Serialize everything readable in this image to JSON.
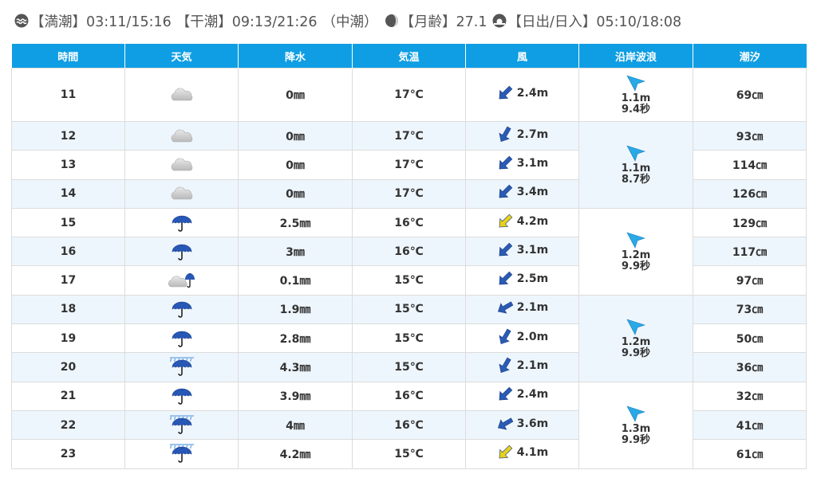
{
  "summary": {
    "tide_high": "【満潮】03:11/15:16",
    "tide_low": "【干潮】09:13/21:26",
    "tide_type": "（中潮）",
    "moon_age": "【月齢】27.1",
    "sun": "【日出/日入】05:10/18:08"
  },
  "headers": [
    "時間",
    "天気",
    "降水",
    "気温",
    "風",
    "沿岸波浪",
    "潮汐"
  ],
  "rows": [
    {
      "hour": "11",
      "weather": "cloudy-icon",
      "rain": "0㎜",
      "temp": "17℃",
      "wind_dir": 225,
      "wind_color": "#2a5bb5",
      "wind": "2.4m",
      "tide": "69㎝"
    },
    {
      "hour": "12",
      "weather": "cloudy-icon",
      "rain": "0㎜",
      "temp": "17℃",
      "wind_dir": 210,
      "wind_color": "#2a5bb5",
      "wind": "2.7m",
      "tide": "93㎝"
    },
    {
      "hour": "13",
      "weather": "cloudy-icon",
      "rain": "0㎜",
      "temp": "17℃",
      "wind_dir": 225,
      "wind_color": "#2a5bb5",
      "wind": "3.1m",
      "tide": "114㎝"
    },
    {
      "hour": "14",
      "weather": "cloudy-icon",
      "rain": "0㎜",
      "temp": "17℃",
      "wind_dir": 225,
      "wind_color": "#2a5bb5",
      "wind": "3.4m",
      "tide": "126㎝"
    },
    {
      "hour": "15",
      "weather": "rain-umbrella-icon",
      "rain": "2.5㎜",
      "temp": "16℃",
      "wind_dir": 225,
      "wind_color": "#e8d21a",
      "wind": "4.2m",
      "tide": "129㎝"
    },
    {
      "hour": "16",
      "weather": "rain-umbrella-icon",
      "rain": "3㎜",
      "temp": "16℃",
      "wind_dir": 225,
      "wind_color": "#2a5bb5",
      "wind": "3.1m",
      "tide": "117㎝"
    },
    {
      "hour": "17",
      "weather": "cloud-umbrella-icon",
      "rain": "0.1㎜",
      "temp": "15℃",
      "wind_dir": 225,
      "wind_color": "#2a5bb5",
      "wind": "2.5m",
      "tide": "97㎝"
    },
    {
      "hour": "18",
      "weather": "rain-umbrella-icon",
      "rain": "1.9㎜",
      "temp": "15℃",
      "wind_dir": 240,
      "wind_color": "#2a5bb5",
      "wind": "2.1m",
      "tide": "73㎝"
    },
    {
      "hour": "19",
      "weather": "rain-umbrella-icon",
      "rain": "2.8㎜",
      "temp": "15℃",
      "wind_dir": 210,
      "wind_color": "#2a5bb5",
      "wind": "2.0m",
      "tide": "50㎝"
    },
    {
      "hour": "20",
      "weather": "heavy-rain-umbrella-icon",
      "rain": "4.3㎜",
      "temp": "15℃",
      "wind_dir": 210,
      "wind_color": "#2a5bb5",
      "wind": "2.1m",
      "tide": "36㎝"
    },
    {
      "hour": "21",
      "weather": "rain-umbrella-icon",
      "rain": "3.9㎜",
      "temp": "16℃",
      "wind_dir": 225,
      "wind_color": "#2a5bb5",
      "wind": "2.4m",
      "tide": "32㎝"
    },
    {
      "hour": "22",
      "weather": "heavy-rain-umbrella-icon",
      "rain": "4㎜",
      "temp": "16℃",
      "wind_dir": 240,
      "wind_color": "#2a5bb5",
      "wind": "3.6m",
      "tide": "41㎝"
    },
    {
      "hour": "23",
      "weather": "heavy-rain-umbrella-icon",
      "rain": "4.2㎜",
      "temp": "15℃",
      "wind_dir": 225,
      "wind_color": "#e8d21a",
      "wind": "4.1m",
      "tide": "61㎝"
    }
  ],
  "waves": [
    {
      "height": "1.1m",
      "period": "9.4秒",
      "span": 1
    },
    {
      "height": "1.1m",
      "period": "8.7秒",
      "span": 3
    },
    {
      "height": "1.2m",
      "period": "9.9秒",
      "span": 3
    },
    {
      "height": "1.2m",
      "period": "9.9秒",
      "span": 3
    },
    {
      "height": "1.3m",
      "period": "9.9秒",
      "span": 3
    }
  ],
  "colors": {
    "header": "#0f9ee3",
    "wave_arrow": "#29a9e6",
    "alt_row": "#eef6fd"
  }
}
